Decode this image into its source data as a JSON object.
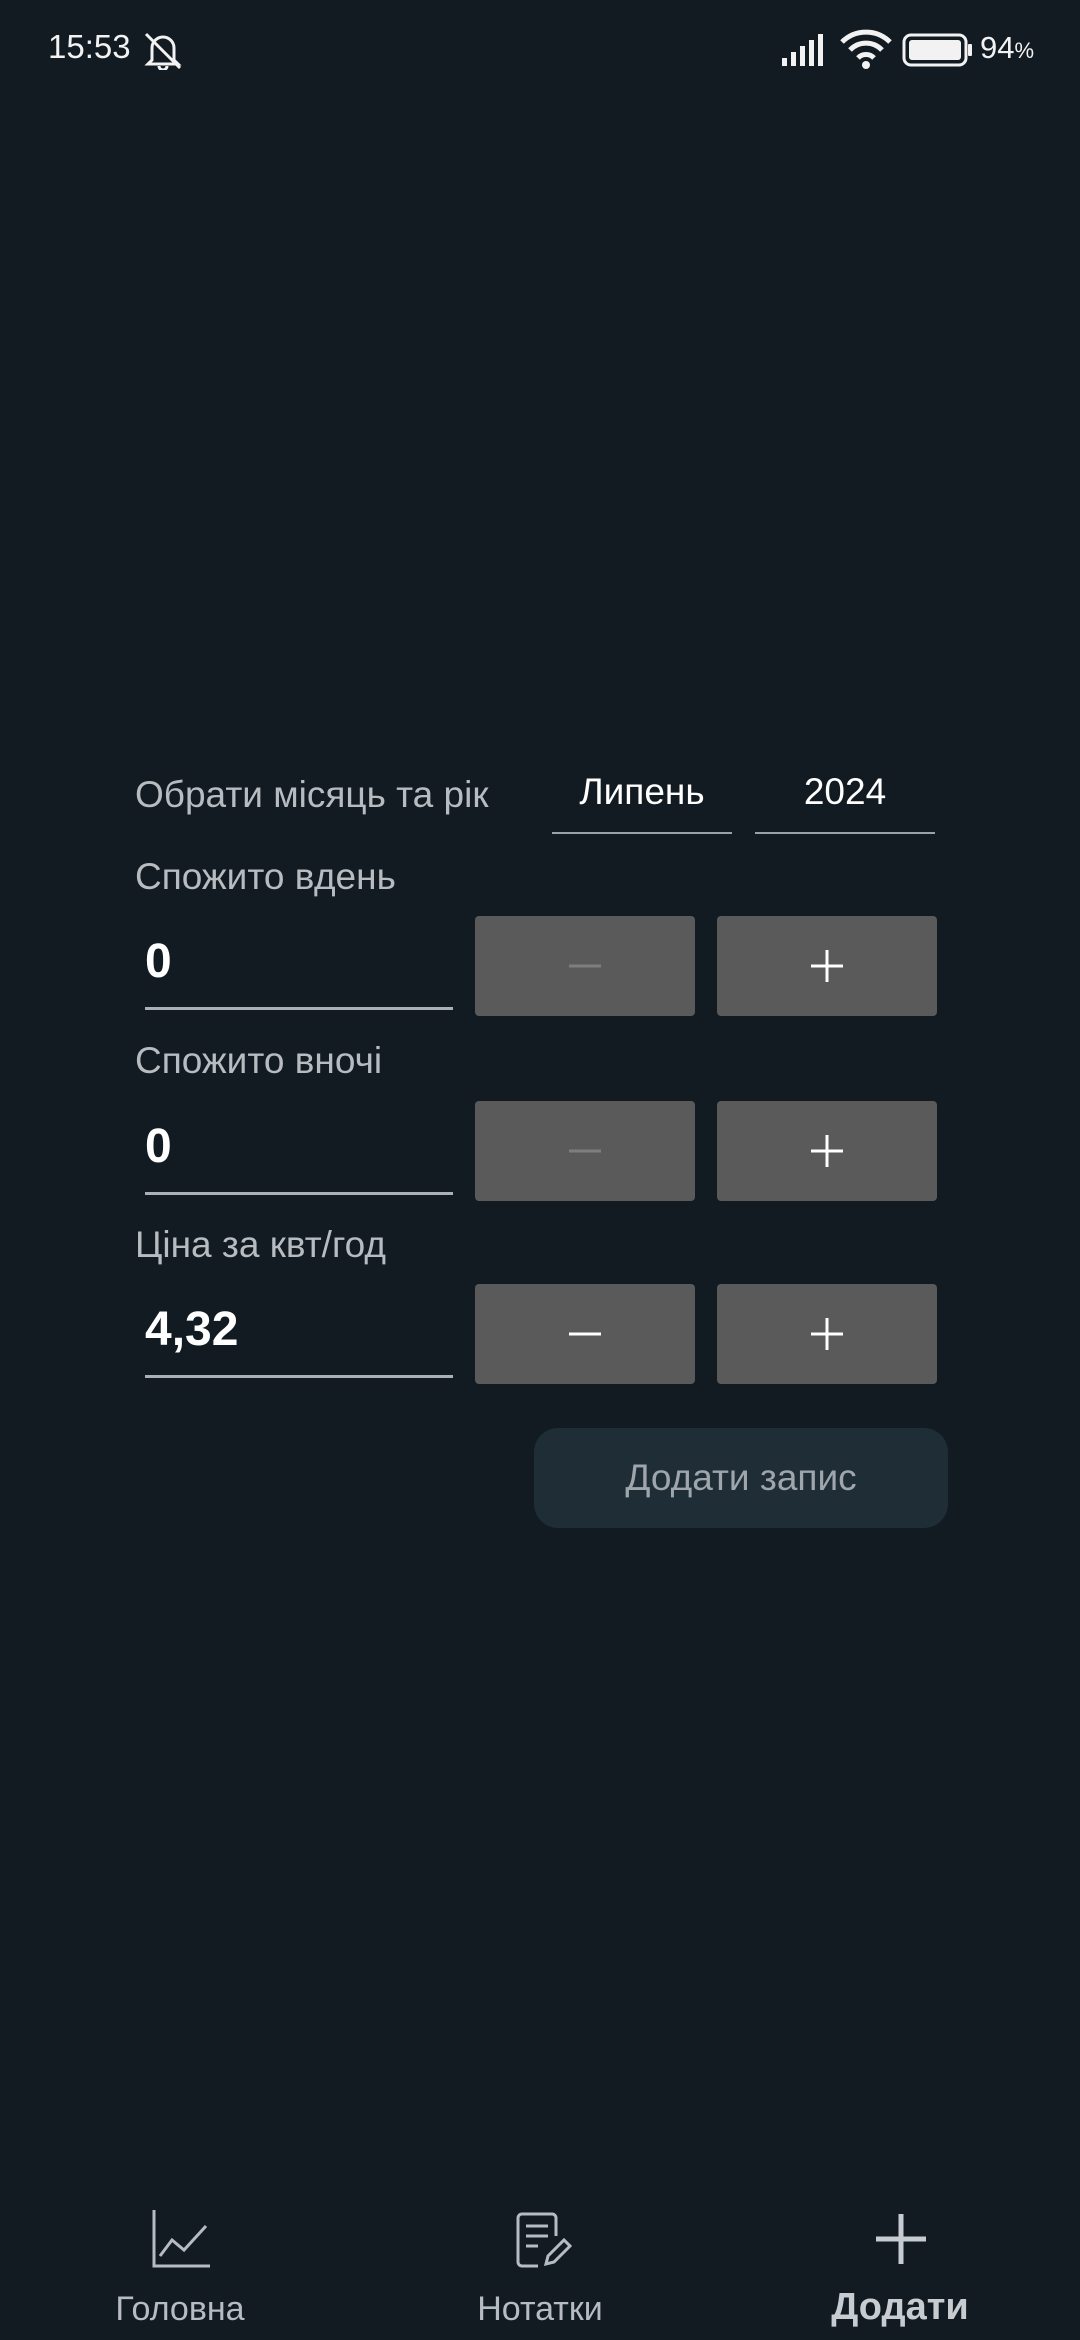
{
  "status_bar": {
    "time": "15:53",
    "battery_level": "94",
    "battery_unit": "%",
    "icons": [
      "bell-muted-icon",
      "signal-icon",
      "wifi-icon",
      "battery-icon"
    ]
  },
  "form": {
    "month_year_label": "Обрати місяць та рік",
    "month_value": "Липень",
    "year_value": "2024",
    "day_label": "Спожито вдень",
    "day_value": "0",
    "night_label": "Спожито вночі",
    "night_value": "0",
    "price_label": "Ціна за квт/год",
    "price_value": "4,32",
    "add_button_label": "Додати запис"
  },
  "bottom_nav": {
    "items": [
      {
        "label": "Головна",
        "icon": "chart-line-icon",
        "active": false
      },
      {
        "label": "Нотатки",
        "icon": "notes-edit-icon",
        "active": false
      },
      {
        "label": "Додати",
        "icon": "plus-icon",
        "active": true
      }
    ]
  },
  "colors": {
    "background": "#121b22",
    "stepper_button": "#5a5a5b",
    "add_record_button": "#1f2d36",
    "label_text": "#b7bcc0"
  }
}
